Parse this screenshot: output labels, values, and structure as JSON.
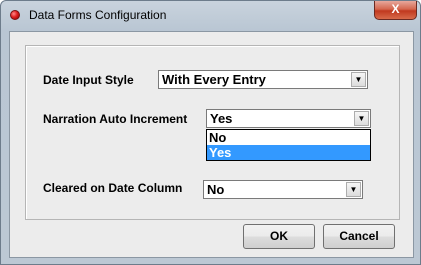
{
  "window": {
    "title": "Data Forms Configuration",
    "close_label": "X"
  },
  "form": {
    "date_input_style": {
      "label": "Date Input Style",
      "value": "With Every Entry"
    },
    "narration_auto_increment": {
      "label": "Narration Auto Increment",
      "value": "Yes",
      "options": [
        "No",
        "Yes"
      ],
      "highlighted": "Yes"
    },
    "cleared_on_date_column": {
      "label": "Cleared on Date Column",
      "value": "No"
    }
  },
  "buttons": {
    "ok": "OK",
    "cancel": "Cancel"
  },
  "icons": {
    "title": "app-icon",
    "dropdown": "chevron-down-icon"
  },
  "colors": {
    "selection": "#3399ff",
    "close_button": "#c0391f"
  }
}
